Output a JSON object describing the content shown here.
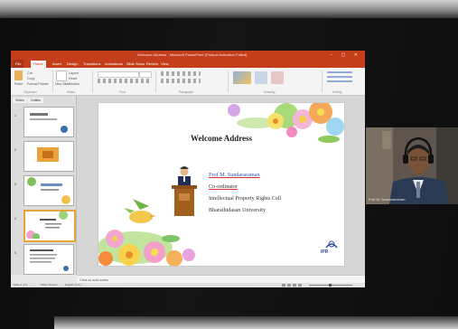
{
  "window": {
    "title": "Welcome Address - Microsoft PowerPoint (Product Activation Failed)",
    "controls": "– ▢ ✕"
  },
  "ribbon_tabs": [
    "File",
    "Home",
    "Insert",
    "Design",
    "Transitions",
    "Animations",
    "Slide Show",
    "Review",
    "View"
  ],
  "ribbon": {
    "paste": "Paste",
    "cut": "Cut",
    "copy": "Copy",
    "format_painter": "Format Painter",
    "new_slide": "New Slide",
    "layout": "Layout",
    "reset": "Reset",
    "section": "Section",
    "groups": [
      "Clipboard",
      "Slides",
      "Font",
      "Paragraph",
      "Drawing",
      "Editing"
    ]
  },
  "pane": {
    "tabs": [
      "Slides",
      "Outline"
    ],
    "slide_numbers": [
      "1",
      "2",
      "3",
      "4",
      "5"
    ],
    "selected_index": 4
  },
  "slide": {
    "title": "Welcome Address",
    "lines": [
      "Prof M. Sundararaman",
      "Co-ordinator",
      "Intellectual Property Rights Cell",
      "Bharathidasan University"
    ],
    "logo": "IPR"
  },
  "notes_placeholder": "Click to add notes",
  "status": {
    "slide_info": "Slide 4 of 5",
    "theme": "\"Office Theme\"",
    "language": "English (U.S.)"
  },
  "video": {
    "participant_name": "Prof M. Sundararaman"
  },
  "colors": {
    "ppt_accent": "#c43e1c",
    "selected_thumb": "#e8a43a"
  }
}
